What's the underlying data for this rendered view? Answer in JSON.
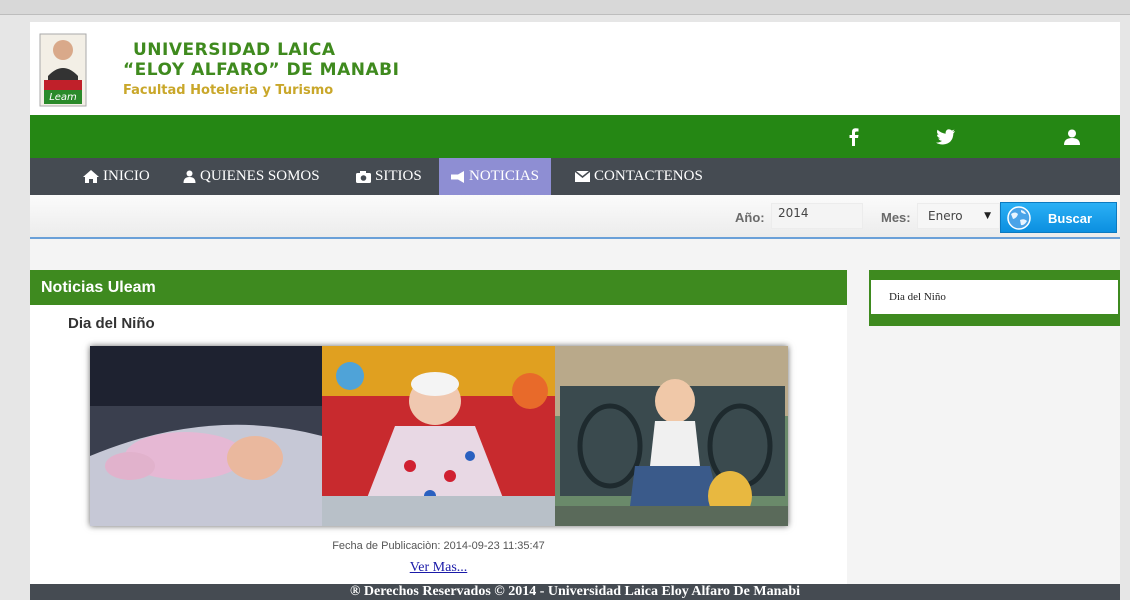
{
  "header": {
    "logo_text": "Leam",
    "title_line1": "UNIVERSIDAD LAICA",
    "title_line2": "“ELOY ALFARO” DE MANABI",
    "title_line3": "Facultad Hoteleria y Turismo"
  },
  "social": {
    "icons": [
      "facebook-icon",
      "twitter-icon",
      "user-icon"
    ]
  },
  "nav": {
    "items": [
      {
        "label": "INICIO",
        "icon": "home-icon"
      },
      {
        "label": "QUIENES SOMOS",
        "icon": "user-icon"
      },
      {
        "label": "SITIOS",
        "icon": "camera-icon"
      },
      {
        "label": "NOTICIAS",
        "icon": "megaphone-icon",
        "active": true
      },
      {
        "label": "CONTACTENOS",
        "icon": "envelope-icon"
      }
    ]
  },
  "search": {
    "year_label": "Año:",
    "year_value": "2014",
    "month_label": "Mes:",
    "month_value": "Enero",
    "button_label": "Buscar"
  },
  "news": {
    "header": "Noticias Uleam",
    "title": "Dia del Niño",
    "date": "Fecha de Publicaciòn: 2014-09-23 11:35:47",
    "more_link": "Ver Mas..."
  },
  "sidebar": {
    "items": [
      "Dia del Niño"
    ]
  },
  "footer": {
    "text": "® Derechos Reservados © 2014  -  Universidad Laica Eloy Alfaro De Manabi"
  },
  "colors": {
    "green": "#3e8a1f",
    "nav_dark": "#454b52",
    "active_tab": "#8e8ed3",
    "button_blue": "#0b8fe0"
  }
}
